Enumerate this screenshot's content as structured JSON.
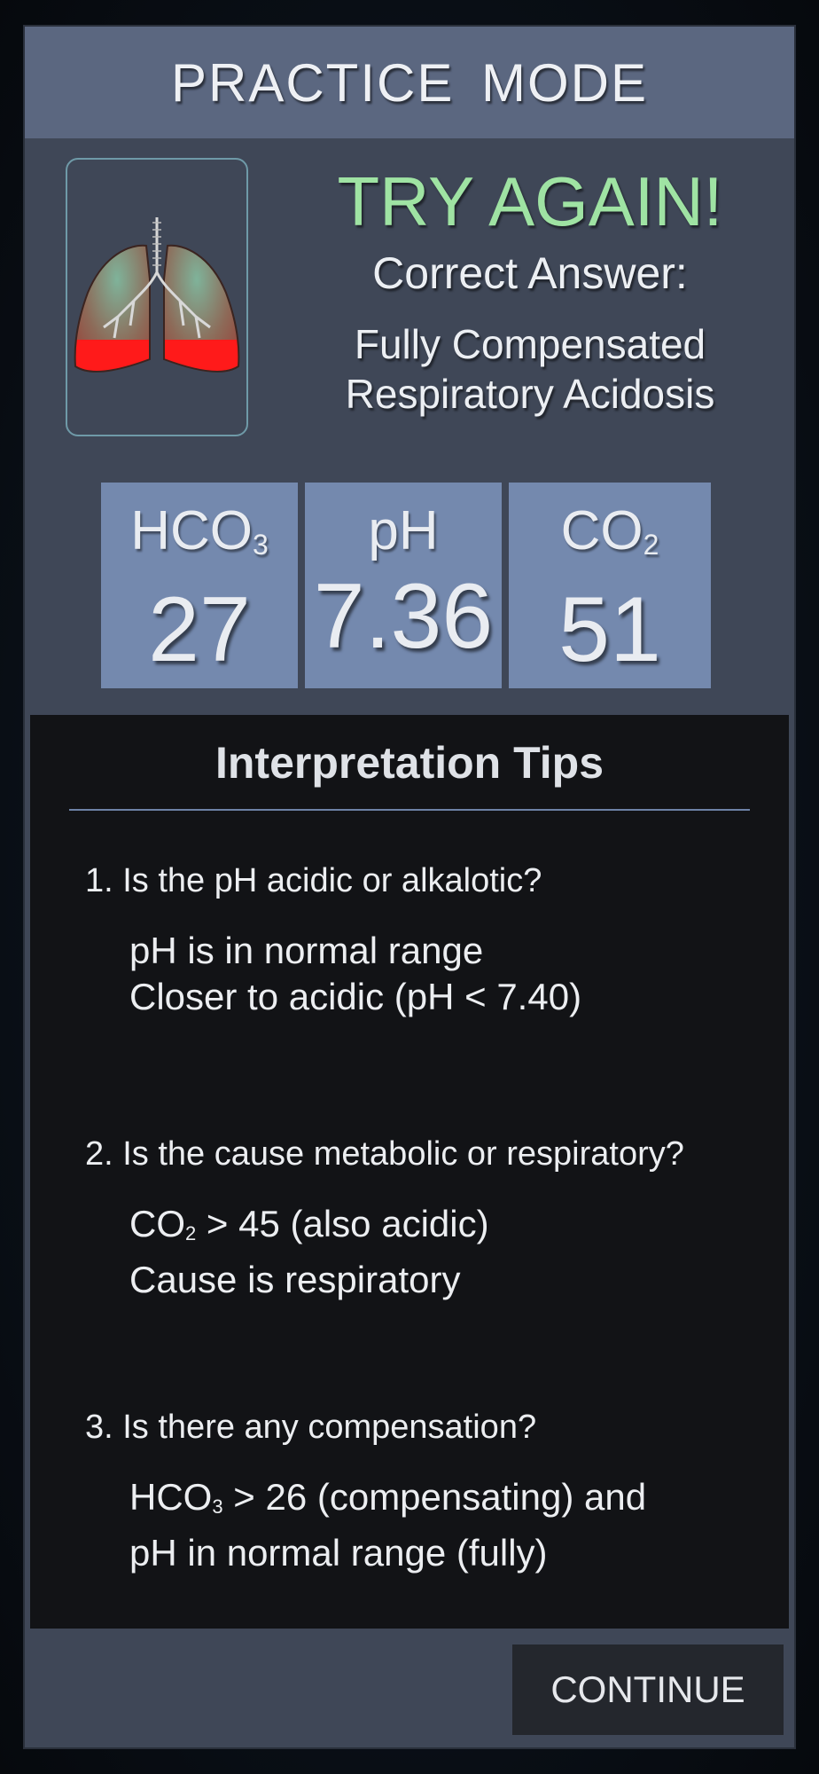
{
  "header": {
    "title": "PRACTICE  MODE"
  },
  "result": {
    "verdict": "TRY AGAIN!",
    "correct_label": "Correct Answer:",
    "answer_line1": "Fully Compensated",
    "answer_line2": "Respiratory Acidosis",
    "verdict_color": "#9fe3a3"
  },
  "values": {
    "hco3": {
      "label": "HCO",
      "sub": "3",
      "value": "27"
    },
    "ph": {
      "label": "pH",
      "value": "7.36"
    },
    "co2": {
      "label": "CO",
      "sub": "2",
      "value": "51"
    }
  },
  "tips": {
    "title": "Interpretation Tips",
    "items": [
      {
        "question": "1. Is the pH acidic or alkalotic?",
        "line1": "pH is in normal range",
        "line2": "Closer to acidic (pH < 7.40)"
      },
      {
        "question": "2. Is the cause metabolic or respiratory?",
        "line1_pre": "CO",
        "line1_sub": "2",
        "line1_post": " > 45 (also acidic)",
        "line2": "Cause is respiratory"
      },
      {
        "question": "3. Is there any compensation?",
        "line1_pre": "HCO",
        "line1_sub": "3",
        "line1_post": " > 26 (compensating) and",
        "line2": "pH in normal range (fully)"
      }
    ]
  },
  "footer": {
    "continue_label": "CONTINUE"
  },
  "icons": {
    "lungs": "lungs-icon"
  },
  "colors": {
    "header_bg": "#5b6780",
    "panel_bg": "#3f4757",
    "value_card_bg": "#7489ae",
    "tips_bg": "#121316",
    "lung_highlight": "#ff1a1a"
  }
}
